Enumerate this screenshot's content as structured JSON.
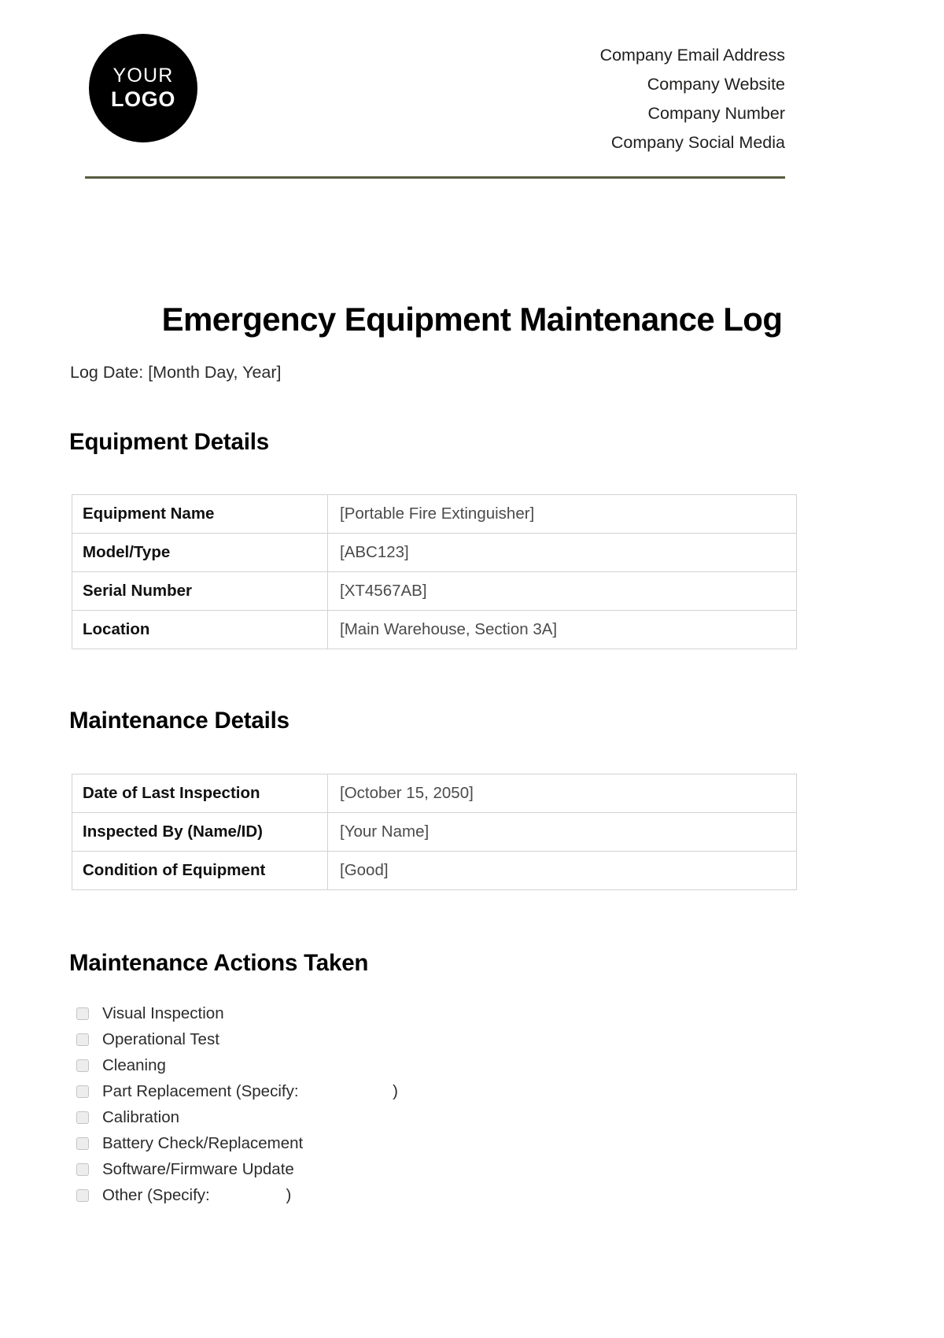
{
  "header": {
    "logo": {
      "line1": "YOUR",
      "line2": "LOGO"
    },
    "contact_lines": [
      "Company Email Address",
      "Company Website",
      "Company Number",
      "Company Social Media"
    ],
    "rule_color": "#575c40"
  },
  "document": {
    "title": "Emergency Equipment Maintenance Log",
    "log_date": "Log Date: [Month Day, Year]"
  },
  "sections": {
    "equipment": {
      "heading": "Equipment Details",
      "rows": [
        {
          "label": "Equipment Name",
          "value": "[Portable Fire Extinguisher]"
        },
        {
          "label": "Model/Type",
          "value": "[ABC123]"
        },
        {
          "label": "Serial Number",
          "value": "[XT4567AB]"
        },
        {
          "label": "Location",
          "value": "[Main Warehouse, Section 3A]"
        }
      ]
    },
    "maintenance": {
      "heading": "Maintenance Details",
      "rows": [
        {
          "label": "Date of Last Inspection",
          "value": "[October 15, 2050]"
        },
        {
          "label": "Inspected By (Name/ID)",
          "value": "[Your Name]"
        },
        {
          "label": "Condition of Equipment",
          "value": "[Good]"
        }
      ]
    },
    "actions": {
      "heading": "Maintenance Actions Taken",
      "items": [
        {
          "label": "Visual Inspection",
          "checked": false
        },
        {
          "label": "Operational Test",
          "checked": false
        },
        {
          "label": "Cleaning",
          "checked": false
        },
        {
          "label": "Part Replacement (Specify:                     )",
          "checked": false
        },
        {
          "label": "Calibration",
          "checked": false
        },
        {
          "label": "Battery Check/Replacement",
          "checked": false
        },
        {
          "label": "Software/Firmware Update",
          "checked": false
        },
        {
          "label": "Other (Specify:                 )",
          "checked": false
        }
      ]
    }
  }
}
